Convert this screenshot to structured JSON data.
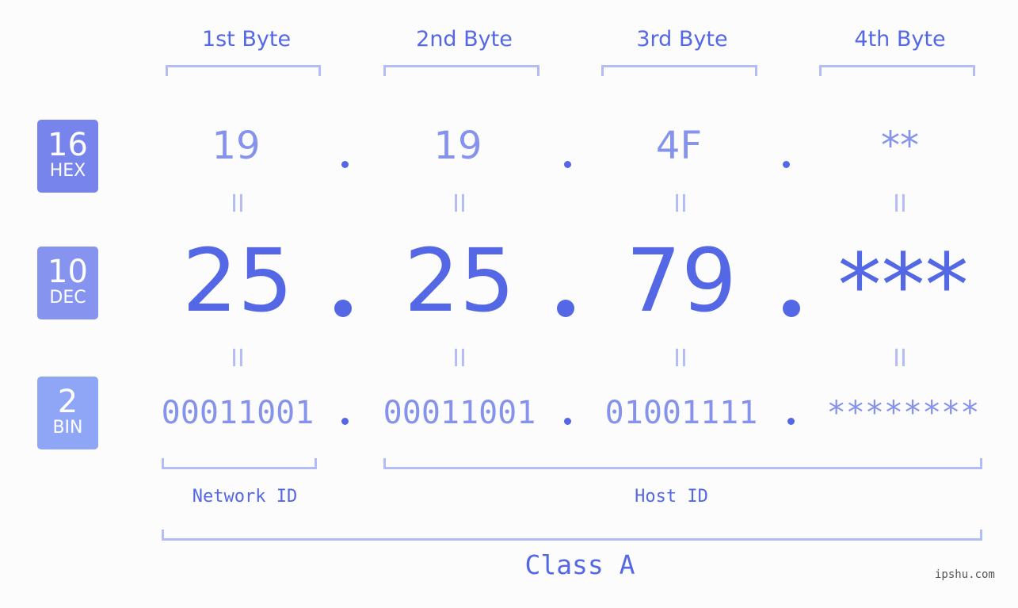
{
  "bytes": [
    "1st Byte",
    "2nd Byte",
    "3rd Byte",
    "4th Byte"
  ],
  "badges": {
    "hex": {
      "number": "16",
      "label": "HEX",
      "color": "#7684ec"
    },
    "dec": {
      "number": "10",
      "label": "DEC",
      "color": "#8693ef"
    },
    "bin": {
      "number": "2",
      "label": "BIN",
      "color": "#8fa5f5"
    }
  },
  "hex_values": [
    "19",
    "19",
    "4F",
    "**"
  ],
  "dec_values": [
    "25",
    "25",
    "79",
    "***"
  ],
  "bin_values": [
    "00011001",
    "00011001",
    "01001111",
    "********"
  ],
  "equals_sign": "II",
  "segments": {
    "network": "Network ID",
    "host": "Host ID"
  },
  "class_label": "Class A",
  "watermark": "ipshu.com",
  "colors": {
    "accent": "#5468e6",
    "light": "#8593ec",
    "bracket": "#b3bcf6"
  }
}
